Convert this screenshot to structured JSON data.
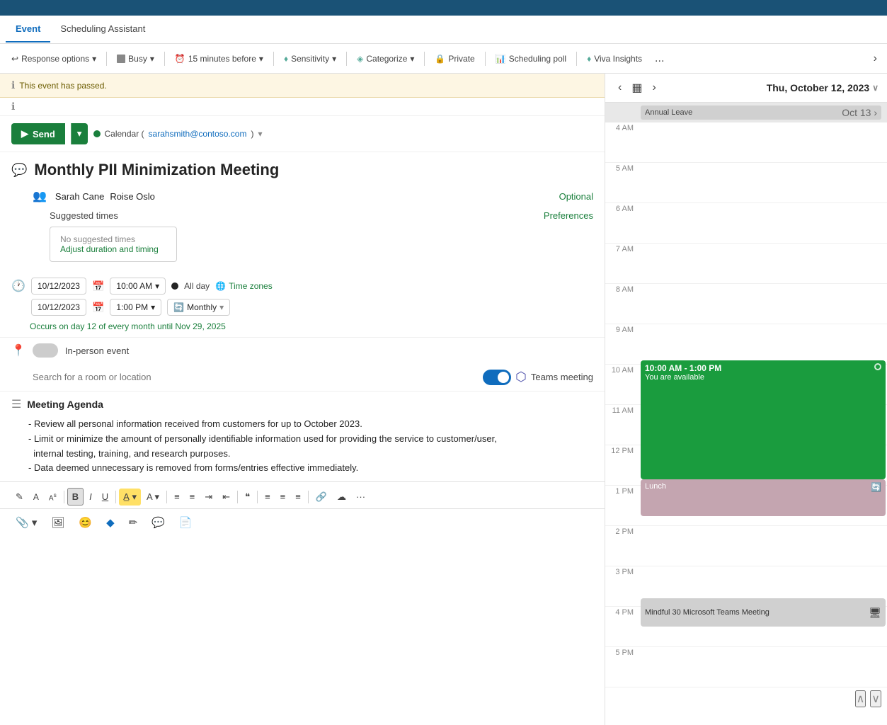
{
  "topbar": {},
  "tabs": {
    "items": [
      {
        "label": "Event",
        "active": true
      },
      {
        "label": "Scheduling Assistant",
        "active": false
      }
    ]
  },
  "toolbar": {
    "buttons": [
      {
        "label": "Response options",
        "icon": "↩",
        "has_chevron": true
      },
      {
        "label": "Busy",
        "icon": "▪",
        "has_chevron": true
      },
      {
        "label": "15 minutes before",
        "icon": "⏰",
        "has_chevron": true
      },
      {
        "label": "Sensitivity",
        "icon": "🛡",
        "has_chevron": true
      },
      {
        "label": "Categorize",
        "icon": "🏷",
        "has_chevron": true
      },
      {
        "label": "Private",
        "icon": "🔒",
        "has_chevron": false
      },
      {
        "label": "Scheduling poll",
        "icon": "📊",
        "has_chevron": false
      },
      {
        "label": "Viva Insights",
        "icon": "💡",
        "has_chevron": false
      }
    ],
    "more": "..."
  },
  "event_passed": {
    "text": "This event has passed.",
    "info2": ""
  },
  "send": {
    "label": "Send",
    "calendar_prefix": "Calendar (",
    "calendar_email": "sarahsmith@contoso.com",
    "calendar_suffix": ")"
  },
  "event": {
    "title": "Monthly PII Minimization Meeting",
    "attendees": [
      {
        "name": "Sarah Cane"
      },
      {
        "name": "Roise Oslo"
      }
    ],
    "optional_label": "Optional",
    "suggested_times_label": "Suggested times",
    "preferences_label": "Preferences",
    "no_suggested": "No suggested times",
    "adjust_label": "Adjust duration and timing",
    "start_date": "10/12/2023",
    "start_time": "10:00 AM",
    "end_date": "10/12/2023",
    "end_time": "1:00 PM",
    "all_day_label": "All day",
    "time_zones_label": "Time zones",
    "recurrence": "Monthly",
    "occurs_text": "Occurs on day 12 of every month until Nov 29, 2025",
    "location_toggle_label": "In-person event",
    "location_placeholder": "Search for a room or location",
    "teams_label": "Teams meeting"
  },
  "body": {
    "title": "Meeting Agenda",
    "content": [
      "- Review all personal information received from customers for up to October 2023.",
      "- Limit or minimize the amount of personally identifiable information used for providing the service to customer/user,\n  internal testing, training, and research purposes.",
      "- Data deemed unnecessary is removed from forms/entries effective immediately."
    ]
  },
  "editor_toolbar": {
    "buttons": [
      "✎",
      "A",
      "Aˢ",
      "B",
      "I",
      "U",
      "A̲",
      "A",
      "≡",
      "≡",
      "⇥",
      "⇤",
      "❝",
      "≡",
      "≡",
      "≡",
      "🔗",
      "☁",
      "···"
    ]
  },
  "attach_bar": {
    "buttons": [
      "📎",
      "🖼",
      "😊",
      "🔷",
      "✏",
      "💬",
      "📄"
    ]
  },
  "calendar": {
    "nav_prev": "‹",
    "nav_next": "›",
    "date_title": "Thu, October 12, 2023",
    "date_chevron": "∨",
    "all_day_label": "Annual Leave",
    "all_day_date": "Oct 13 ›",
    "times": [
      {
        "label": "4 AM"
      },
      {
        "label": "5 AM"
      },
      {
        "label": "6 AM"
      },
      {
        "label": "7 AM"
      },
      {
        "label": "8 AM"
      },
      {
        "label": "9 AM"
      },
      {
        "label": "10 AM"
      },
      {
        "label": "11 AM"
      },
      {
        "label": "12 PM"
      },
      {
        "label": "1 PM"
      },
      {
        "label": "2 PM"
      },
      {
        "label": "3 PM"
      },
      {
        "label": "4 PM"
      },
      {
        "label": "5 PM"
      }
    ],
    "main_event": {
      "time": "10:00 AM - 1:00 PM",
      "status": "You are available"
    },
    "lunch_event": {
      "label": "Lunch"
    },
    "mindful_event": {
      "label": "Mindful 30 Microsoft Teams Meeting"
    }
  }
}
